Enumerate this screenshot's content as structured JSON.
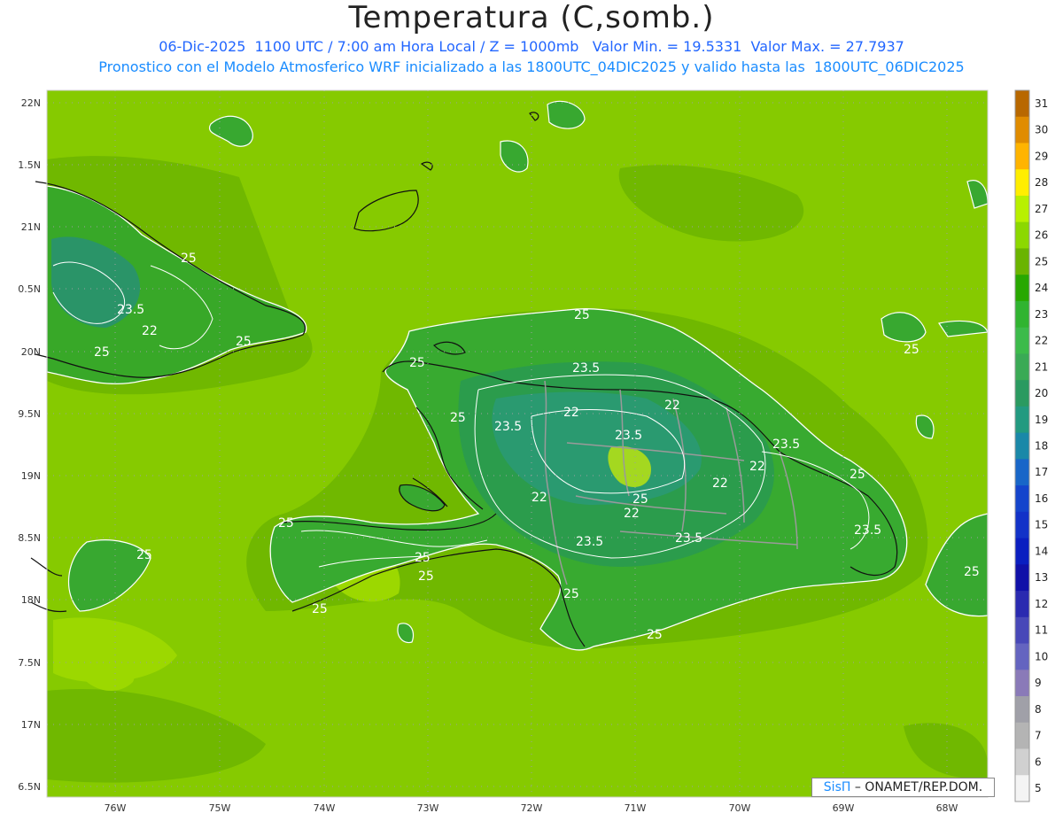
{
  "title": "Temperatura (C,somb.)",
  "subtitle_1": "06-Dic-2025  1100 UTC / 7:00 am Hora Local / Z = 1000mb   Valor Min. = 19.5331  Valor Max. = 27.7937",
  "subtitle_2": "Pronostico con el Modelo Atmosferico WRF inicializado a las 1800UTC_04DIC2025 y valido hasta las  1800UTC_06DIC2025",
  "lat_labels": [
    "22N",
    "1.5N",
    "21N",
    "0.5N",
    "20N",
    "9.5N",
    "19N",
    "8.5N",
    "18N",
    "7.5N",
    "17N",
    "6.5N"
  ],
  "lon_labels": [
    "76W",
    "75W",
    "74W",
    "73W",
    "72W",
    "71W",
    "70W",
    "69W",
    "68W"
  ],
  "colorbar": {
    "labels": [
      "31",
      "30",
      "29",
      "28",
      "27",
      "26",
      "25",
      "24",
      "23",
      "22",
      "21",
      "20",
      "19",
      "18",
      "17",
      "16",
      "15",
      "14",
      "13",
      "12",
      "11",
      "10",
      "9",
      "8",
      "7",
      "6",
      "5"
    ],
    "colors": [
      "#b86800",
      "#e08c00",
      "#ffb400",
      "#ffee00",
      "#b8f000",
      "#8cd800",
      "#6ab400",
      "#28a800",
      "#30b430",
      "#3cbb4a",
      "#3aaa55",
      "#2a9a60",
      "#229a80",
      "#1a88a8",
      "#1866c8",
      "#1444cc",
      "#1232c8",
      "#0a1ec0",
      "#1010a8",
      "#2a2ab0",
      "#4848b8",
      "#6464c0",
      "#8a7ab8",
      "#a0a0a8",
      "#b4b4b4",
      "#d0d0d0",
      "#f4f4f4"
    ]
  },
  "contour_labels": [
    "25",
    "23.5",
    "22",
    "25",
    "25",
    "25",
    "23.5",
    "25",
    "22",
    "22",
    "23.5",
    "25",
    "23.5",
    "25",
    "23.5",
    "22",
    "22",
    "22",
    "23.5",
    "22",
    "25",
    "23.5",
    "23.5",
    "25",
    "25",
    "25",
    "25",
    "25",
    "25",
    "25",
    "25",
    "25"
  ],
  "credit": {
    "brand": "SisΠ",
    "text": " – ONAMET/REP.DOM."
  },
  "colors": {
    "sea": "#8ccf00",
    "land": "#3aa828",
    "mountain": "#2c9a4a",
    "highland": "#b4e400"
  }
}
